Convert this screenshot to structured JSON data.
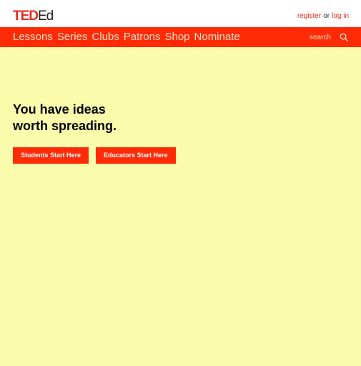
{
  "logo": {
    "ted": "TED",
    "ed": "Ed"
  },
  "account": {
    "register": "register",
    "or": "or",
    "login": "log in"
  },
  "nav": {
    "items": [
      "Lessons",
      "Series",
      "Clubs",
      "Patrons",
      "Shop",
      "Nominate"
    ],
    "search_label": "search",
    "search_icon": "search-icon"
  },
  "hero": {
    "line1": "You have ideas",
    "line2": "worth spreading.",
    "students_button": "Students Start Here",
    "educators_button": "Educators Start Here"
  },
  "colors": {
    "brand_red": "#ff2b06",
    "logo_red": "#e62b1e",
    "background": "#fafcac"
  }
}
